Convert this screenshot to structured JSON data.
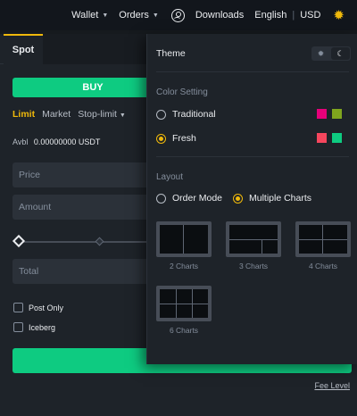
{
  "topnav": {
    "wallet": "Wallet",
    "orders": "Orders",
    "downloads": "Downloads",
    "language": "English",
    "separator": "|",
    "currency": "USD"
  },
  "trade": {
    "tab_spot": "Spot",
    "buy_label": "BUY",
    "order_types": [
      "Limit",
      "Market",
      "Stop-limit"
    ],
    "avbl_label": "Avbl",
    "avbl_value": "0.00000000 USDT",
    "price_placeholder": "Price",
    "amount_placeholder": "Amount",
    "total_placeholder": "Total",
    "post_only": "Post Only",
    "iceberg": "Iceberg",
    "fee_level": "Fee Level"
  },
  "settings": {
    "theme_title": "Theme",
    "theme_selected": "dark",
    "color_setting_title": "Color Setting",
    "color_options": [
      {
        "label": "Traditional",
        "checked": false,
        "colors": [
          "#e6007a",
          "#7fa51e"
        ]
      },
      {
        "label": "Fresh",
        "checked": true,
        "colors": [
          "#f6465d",
          "#0ecb81"
        ]
      }
    ],
    "layout_title": "Layout",
    "layout_modes": [
      {
        "label": "Order Mode",
        "checked": false
      },
      {
        "label": "Multiple Charts",
        "checked": true
      }
    ],
    "chart_layouts": [
      "2 Charts",
      "3 Charts",
      "4 Charts",
      "6 Charts"
    ]
  },
  "colors": {
    "accent": "#f0b90b",
    "buy": "#0ecb81"
  }
}
